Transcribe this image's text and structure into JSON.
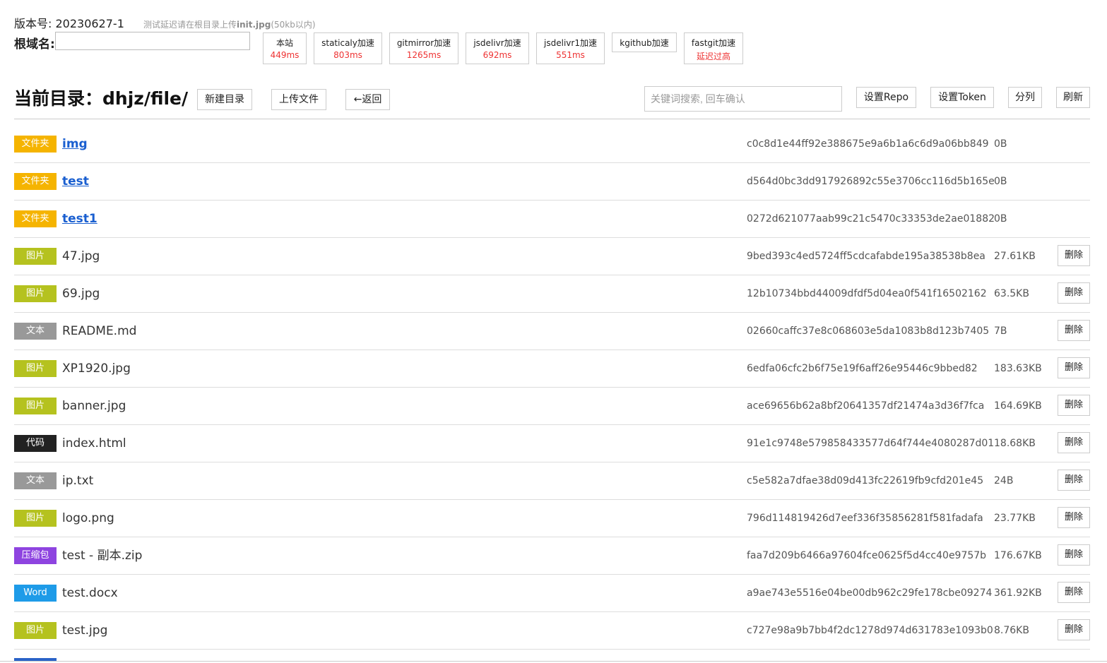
{
  "header": {
    "version_label": "版本号: 20230627-1",
    "hint_prefix": "测试延迟请在根目录上传",
    "hint_file": "init.jpg",
    "hint_suffix": "(50kb以内)",
    "root_label": "根域名:",
    "root_value": ""
  },
  "cdns": [
    {
      "name": "本站",
      "latency": "449ms"
    },
    {
      "name": "staticaly加速",
      "latency": "803ms"
    },
    {
      "name": "gitmirror加速",
      "latency": "1265ms"
    },
    {
      "name": "jsdelivr加速",
      "latency": "692ms"
    },
    {
      "name": "jsdelivr1加速",
      "latency": "551ms"
    },
    {
      "name": "kgithub加速",
      "latency": ""
    },
    {
      "name": "fastgit加速",
      "latency": "延迟过高"
    }
  ],
  "toolbar": {
    "title": "当前目录：dhjz/file/",
    "new_dir": "新建目录",
    "upload": "上传文件",
    "back": "←返回",
    "search_placeholder": "关键词搜索, 回车确认",
    "set_repo": "设置Repo",
    "set_token": "设置Token",
    "split": "分列",
    "refresh": "刷新"
  },
  "delete_label": "删除",
  "colors": {
    "folder": "#f5b400",
    "image": "#b5c21f",
    "text": "#999999",
    "code": "#222222",
    "zip": "#8e44e0",
    "word": "#1e9be8"
  },
  "files": [
    {
      "type": "文件夹",
      "kind": "folder",
      "name": "img",
      "hash": "c0c8d1e44ff92e388675e9a6b1a6c6d9a06bb849",
      "size": "0B",
      "deletable": false
    },
    {
      "type": "文件夹",
      "kind": "folder",
      "name": "test",
      "hash": "d564d0bc3dd917926892c55e3706cc116d5b165e",
      "size": "0B",
      "deletable": false
    },
    {
      "type": "文件夹",
      "kind": "folder",
      "name": "test1",
      "hash": "0272d621077aab99c21c5470c33353de2ae01882",
      "size": "0B",
      "deletable": false
    },
    {
      "type": "图片",
      "kind": "image",
      "name": "47.jpg",
      "hash": "9bed393c4ed5724ff5cdcafabde195a38538b8ea",
      "size": "27.61KB",
      "deletable": true
    },
    {
      "type": "图片",
      "kind": "image",
      "name": "69.jpg",
      "hash": "12b10734bbd44009dfdf5d04ea0f541f16502162",
      "size": "63.5KB",
      "deletable": true
    },
    {
      "type": "文本",
      "kind": "text",
      "name": "README.md",
      "hash": "02660caffc37e8c068603e5da1083b8d123b7405",
      "size": "7B",
      "deletable": true
    },
    {
      "type": "图片",
      "kind": "image",
      "name": "XP1920.jpg",
      "hash": "6edfa06cfc2b6f75e19f6aff26e95446c9bbed82",
      "size": "183.63KB",
      "deletable": true
    },
    {
      "type": "图片",
      "kind": "image",
      "name": "banner.jpg",
      "hash": "ace69656b62a8bf20641357df21474a3d36f7fca",
      "size": "164.69KB",
      "deletable": true
    },
    {
      "type": "代码",
      "kind": "code",
      "name": "index.html",
      "hash": "91e1c9748e579858433577d64f744e4080287d01",
      "size": "18.68KB",
      "deletable": true
    },
    {
      "type": "文本",
      "kind": "text",
      "name": "ip.txt",
      "hash": "c5e582a7dfae38d09d413fc22619fb9cfd201e45",
      "size": "24B",
      "deletable": true
    },
    {
      "type": "图片",
      "kind": "image",
      "name": "logo.png",
      "hash": "796d114819426d7eef336f35856281f581fadafa",
      "size": "23.77KB",
      "deletable": true
    },
    {
      "type": "压缩包",
      "kind": "zip",
      "name": "test - 副本.zip",
      "hash": "faa7d209b6466a97604fce0625f5d4cc40e9757b",
      "size": "176.67KB",
      "deletable": true
    },
    {
      "type": "Word",
      "kind": "word",
      "name": "test.docx",
      "hash": "a9ae743e5516e04be00db962c29fe178cbe09274",
      "size": "361.92KB",
      "deletable": true
    },
    {
      "type": "图片",
      "kind": "image",
      "name": "test.jpg",
      "hash": "c727e98a9b7bb4f2dc1278d974d631783e1093b0",
      "size": "8.76KB",
      "deletable": true
    }
  ]
}
